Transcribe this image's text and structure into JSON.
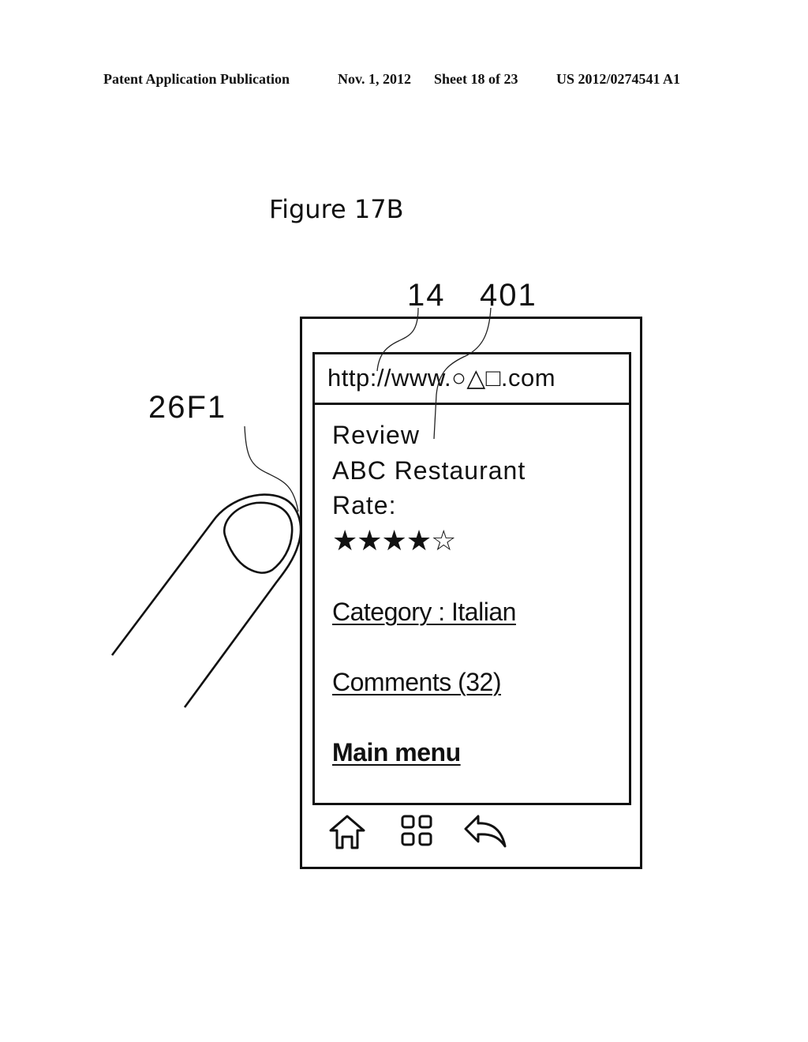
{
  "header": {
    "publication": "Patent Application Publication",
    "date": "Nov. 1, 2012",
    "sheet": "Sheet 18 of 23",
    "number": "US 2012/0274541 A1"
  },
  "figure": {
    "title": "Figure 17B",
    "refs": {
      "url_bar": "14",
      "content_area": "401",
      "finger_contact": "26F1"
    }
  },
  "browser": {
    "url": "http://www.○△□.com",
    "content": {
      "heading": "Review",
      "name": "ABC  Restaurant",
      "rate_label": "Rate:",
      "rating": {
        "value": 4,
        "max": 5,
        "display": "★★★★☆"
      },
      "links": [
        {
          "label": "Category : Italian"
        },
        {
          "label": "Comments (32)"
        },
        {
          "label": "Main menu"
        }
      ]
    },
    "nav": [
      {
        "icon": "home-icon"
      },
      {
        "icon": "grid-icon"
      },
      {
        "icon": "back-arrow-icon"
      }
    ]
  }
}
